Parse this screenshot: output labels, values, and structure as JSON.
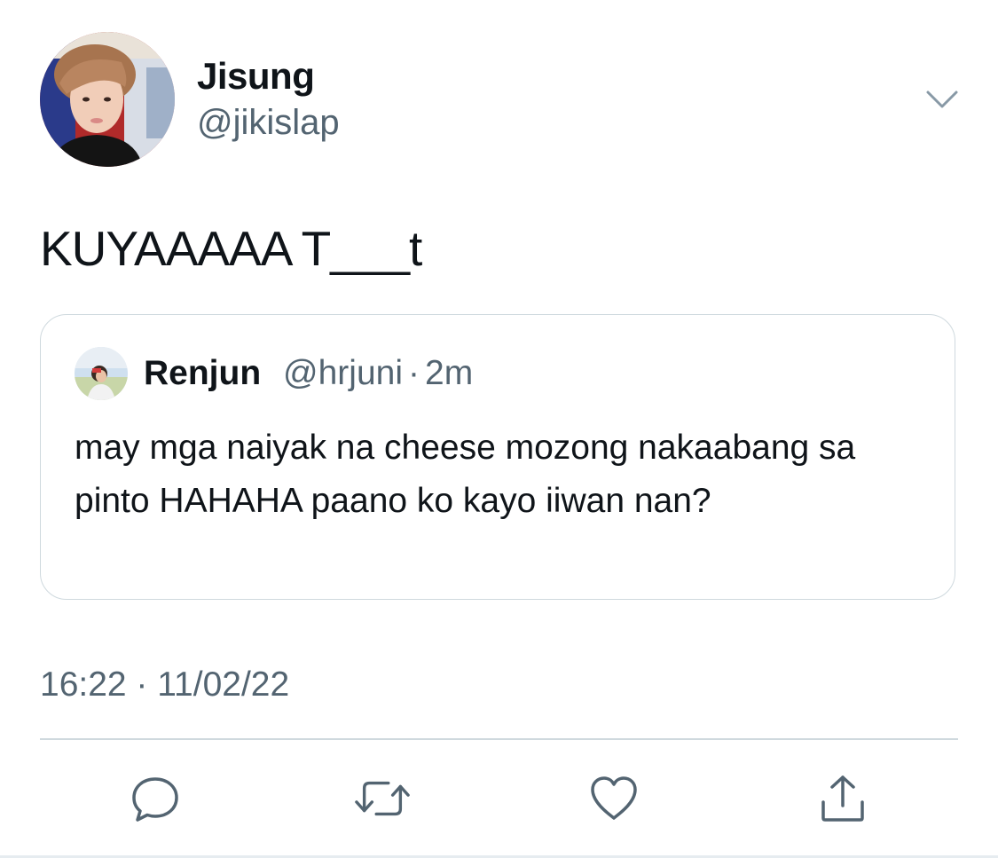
{
  "tweet": {
    "author": {
      "name": "Jisung",
      "handle": "@jikislap"
    },
    "text": "KUYAAAAA T___t",
    "timestamp": "16:22 · 11/02/22",
    "more_icon": "chevron-down-icon"
  },
  "quoted_tweet": {
    "name": "Renjun",
    "handle": "@hrjuni",
    "separator": "·",
    "time": "2m",
    "text": "may mga naiyak na cheese mozong nakaabang sa pinto HAHAHA paano ko kayo iiwan nan?"
  },
  "actions": [
    {
      "name": "reply",
      "icon": "reply-bubble-icon"
    },
    {
      "name": "retweet",
      "icon": "retweet-arrows-icon"
    },
    {
      "name": "like",
      "icon": "heart-icon"
    },
    {
      "name": "share",
      "icon": "share-upload-icon"
    }
  ],
  "colors": {
    "text_primary": "#0f1419",
    "text_secondary": "#536471",
    "border": "#cfd9de",
    "icon": "#536471"
  }
}
